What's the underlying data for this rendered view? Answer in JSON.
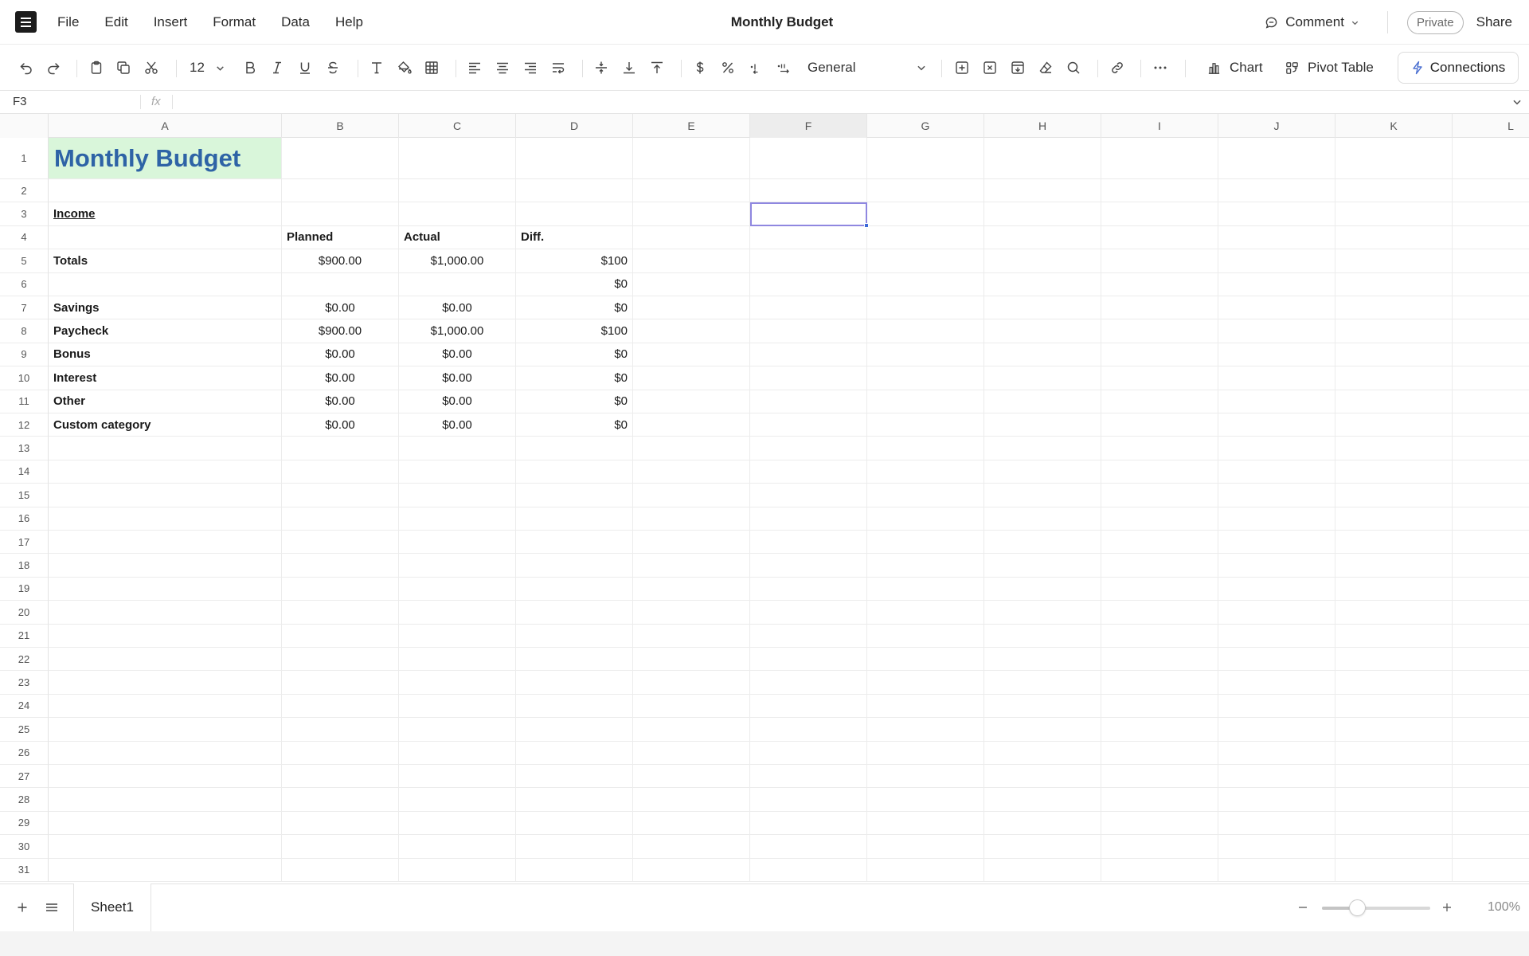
{
  "app": {
    "menu": [
      "File",
      "Edit",
      "Insert",
      "Format",
      "Data",
      "Help"
    ],
    "document_title": "Monthly Budget",
    "comment_label": "Comment",
    "private_label": "Private",
    "share_label": "Share"
  },
  "toolbar": {
    "font_size": "12",
    "number_format": "General",
    "chart_label": "Chart",
    "pivot_label": "Pivot Table",
    "connections_label": "Connections"
  },
  "formula_bar": {
    "cell_ref": "F3",
    "fx_label": "fx",
    "formula": ""
  },
  "grid": {
    "active_column": "F",
    "active_cell": "F3",
    "columns": [
      "A",
      "B",
      "C",
      "D",
      "E",
      "F",
      "G",
      "H",
      "I",
      "J",
      "K",
      "L"
    ],
    "row_numbers": [
      "1",
      "2",
      "3",
      "4",
      "5",
      "6",
      "7",
      "8",
      "9",
      "10",
      "11",
      "12",
      "13",
      "14",
      "15",
      "16",
      "17",
      "18",
      "19",
      "20",
      "21",
      "22",
      "23",
      "24",
      "25",
      "26",
      "27",
      "28",
      "29",
      "30",
      "31"
    ],
    "title": "Monthly Budget",
    "section_label": "Income",
    "headers": {
      "planned": "Planned",
      "actual": "Actual",
      "diff": "Diff."
    },
    "totals": {
      "label": "Totals",
      "planned": "$900.00",
      "actual": "$1,000.00",
      "diff": "$100"
    },
    "row6_diff": "$0",
    "items": [
      {
        "label": "Savings",
        "planned": "$0.00",
        "actual": "$0.00",
        "diff": "$0"
      },
      {
        "label": "Paycheck",
        "planned": "$900.00",
        "actual": "$1,000.00",
        "diff": "$100"
      },
      {
        "label": "Bonus",
        "planned": "$0.00",
        "actual": "$0.00",
        "diff": "$0"
      },
      {
        "label": "Interest",
        "planned": "$0.00",
        "actual": "$0.00",
        "diff": "$0"
      },
      {
        "label": "Other",
        "planned": "$0.00",
        "actual": "$0.00",
        "diff": "$0"
      },
      {
        "label": "Custom category",
        "planned": "$0.00",
        "actual": "$0.00",
        "diff": "$0"
      }
    ]
  },
  "footer": {
    "sheet_tab": "Sheet1",
    "zoom_label": "100%",
    "zoom_fraction": 0.33
  },
  "colors": {
    "title_text": "#2e63a6",
    "title_fill": "#d9f6da",
    "selection_border": "#8f87e0",
    "selection_handle": "#3b68d8"
  }
}
